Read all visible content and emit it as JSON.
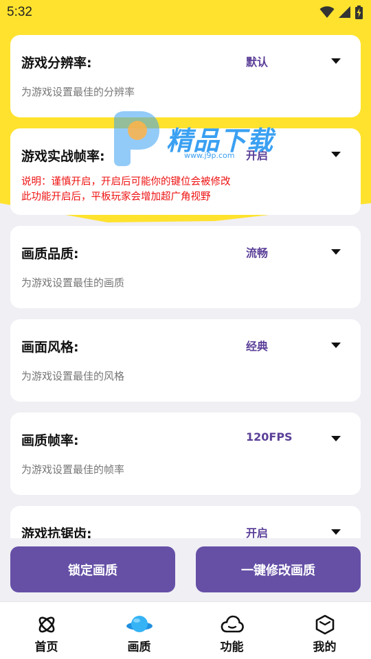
{
  "status_bar": {
    "time": "5:32",
    "icons": [
      "wifi-icon",
      "signal-icon",
      "battery-charging-icon"
    ]
  },
  "colors": {
    "header_yellow": "#ffe22e",
    "accent_purple": "#6550a6",
    "value_purple": "#5b3f98",
    "note_red": "#ee1111",
    "background": "#f0eff4"
  },
  "settings": [
    {
      "title": "游戏分辨率:",
      "value": "默认",
      "description": "为游戏设置最佳的分辨率"
    },
    {
      "title": "游戏实战帧率:",
      "value": "开启",
      "note_lines": [
        "说明：谨慎开启，开启后可能你的键位会被修改",
        "此功能开启后，平板玩家会增加超广角视野"
      ]
    },
    {
      "title": "画质品质:",
      "value": "流畅",
      "description": "为游戏设置最佳的画质"
    },
    {
      "title": "画面风格:",
      "value": "经典",
      "description": "为游戏设置最佳的风格"
    },
    {
      "title": "画质帧率:",
      "value": "120FPS",
      "description": "为游戏设置最佳的帧率"
    },
    {
      "title": "游戏抗锯齿:",
      "value": "开启"
    }
  ],
  "watermark": {
    "text": "精品下载",
    "url": "www.j9p.com"
  },
  "actions": {
    "lock_label": "锁定画质",
    "apply_label": "一键修改画质"
  },
  "tabs": [
    {
      "label": "首页",
      "icon": "atom-icon"
    },
    {
      "label": "画质",
      "icon": "planet-icon",
      "active": true
    },
    {
      "label": "功能",
      "icon": "cloud-icon"
    },
    {
      "label": "我的",
      "icon": "cube-icon"
    }
  ]
}
